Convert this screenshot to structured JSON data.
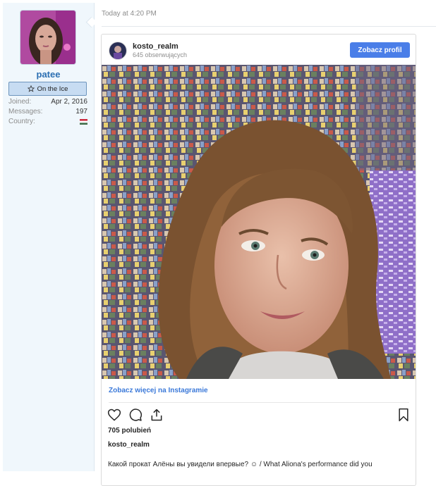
{
  "user": {
    "name": "patee",
    "title": "On the Ice",
    "joined_label": "Joined:",
    "joined_value": "Apr 2, 2016",
    "messages_label": "Messages:",
    "messages_value": "197",
    "country_label": "Country:"
  },
  "post": {
    "timestamp": "Today at 4:20 PM"
  },
  "instagram": {
    "handle": "kosto_realm",
    "followers": "645 obserwujących",
    "view_profile_label": "Zobacz profil",
    "view_more_label": "Zobacz więcej na Instagramie",
    "likes": "705 polubień",
    "caption_handle": "kosto_realm",
    "caption": "Какой прокат Алёны вы увидели впервые? ☺ / What Aliona's performance did you"
  },
  "colors": {
    "accent": "#4a7ee8",
    "username": "#2b6fb2",
    "sidebar_bg": "#f0f7fc",
    "link": "#3b79d9"
  }
}
